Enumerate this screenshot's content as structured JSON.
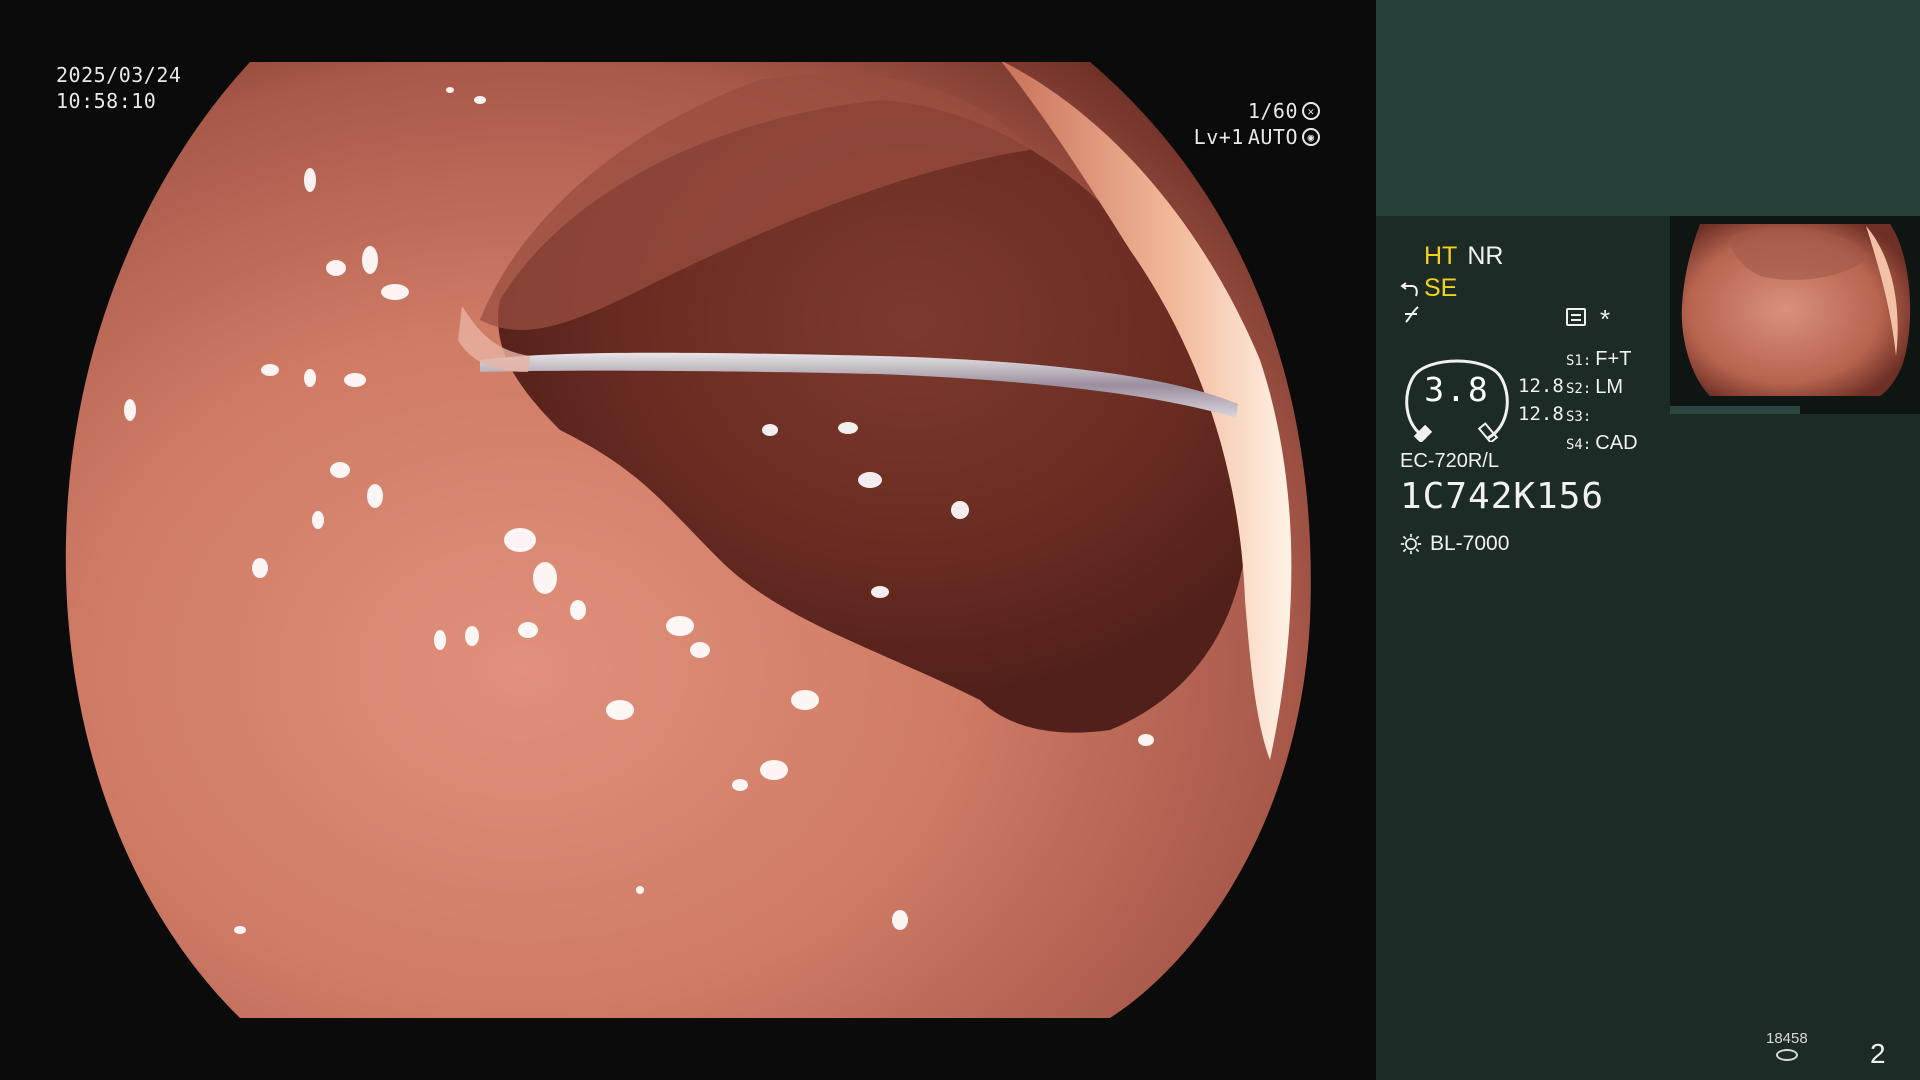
{
  "video": {
    "date": "2025/03/24",
    "time": "10:58:10",
    "shutter": "1/60",
    "level": "Lv+1",
    "iris": "AUTO"
  },
  "panel": {
    "mode_ht": "HT",
    "mode_nr": "NR",
    "mode_se": "SE",
    "gauge_value": "3.8",
    "value_1": "12.8",
    "value_2": "12.8",
    "switches": [
      {
        "key": "S1:",
        "value": "F+T"
      },
      {
        "key": "S2:",
        "value": "LM"
      },
      {
        "key": "S3:",
        "value": ""
      },
      {
        "key": "S4:",
        "value": "CAD"
      }
    ],
    "asterisk": "*",
    "scope_model": "EC-720R/L",
    "scope_serial": "1C742K156",
    "light_source": "BL-7000",
    "counter": "18458",
    "page": "2"
  },
  "colors": {
    "panel_bg": "#1d2b27",
    "panel_top": "#254038",
    "highlight": "#f2d21a",
    "tissue": "#c97a66"
  },
  "icons": {
    "shutter": "shutter-icon",
    "iris": "iris-icon",
    "scope_bend": "scope-bend-icon",
    "freeze": "freeze-icon",
    "menu": "menu-icon",
    "light": "sun-icon",
    "storage": "disk-icon"
  }
}
